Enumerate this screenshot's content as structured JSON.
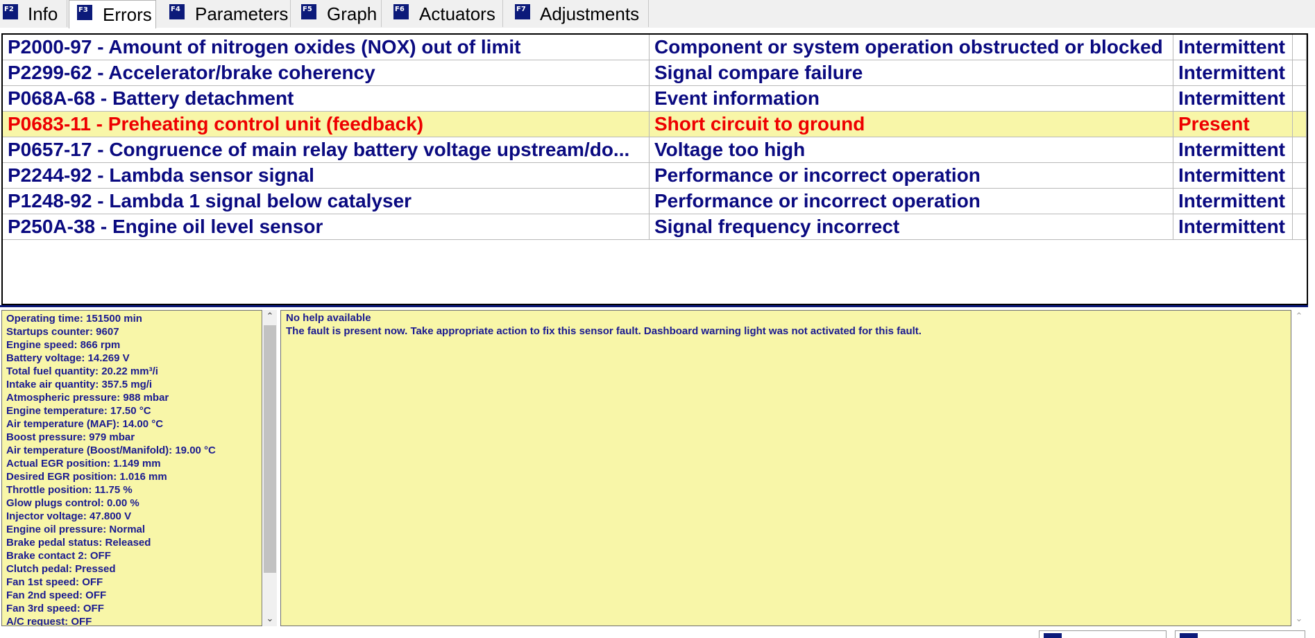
{
  "tabs": [
    {
      "key": "F2",
      "label": "Info",
      "active": false
    },
    {
      "key": "F3",
      "label": "Errors",
      "active": true
    },
    {
      "key": "F4",
      "label": "Parameters",
      "active": false
    },
    {
      "key": "F5",
      "label": "Graph",
      "active": false
    },
    {
      "key": "F6",
      "label": "Actuators",
      "active": false
    },
    {
      "key": "F7",
      "label": "Adjustments",
      "active": false
    }
  ],
  "errors": [
    {
      "code": "P2000-97 - Amount of nitrogen oxides (NOX) out of limit",
      "description": "Component or system operation obstructed or blocked",
      "type": "Intermittent"
    },
    {
      "code": "P2299-62 - Accelerator/brake coherency",
      "description": "Signal compare failure",
      "type": "Intermittent"
    },
    {
      "code": "P068A-68 - Battery detachment",
      "description": "Event information",
      "type": "Intermittent"
    },
    {
      "code": "P0683-11 - Preheating control unit (feedback)",
      "description": "Short circuit to ground",
      "type": "Present",
      "selected": true
    },
    {
      "code": "P0657-17 - Congruence of main relay battery voltage upstream/do...",
      "description": "Voltage too high",
      "type": "Intermittent"
    },
    {
      "code": "P2244-92 - Lambda sensor signal",
      "description": "Performance or incorrect operation",
      "type": "Intermittent"
    },
    {
      "code": "P1248-92 - Lambda 1 signal below catalyser",
      "description": "Performance or incorrect operation",
      "type": "Intermittent"
    },
    {
      "code": "P250A-38 - Engine oil level sensor",
      "description": "Signal frequency incorrect",
      "type": "Intermittent"
    }
  ],
  "parameters": [
    "Operating time: 151500 min",
    "Startups counter: 9607",
    "Engine speed: 866 rpm",
    "Battery voltage: 14.269 V",
    "Total fuel quantity: 20.22 mm³/i",
    "Intake air quantity: 357.5 mg/i",
    "Atmospheric pressure: 988 mbar",
    "Engine temperature: 17.50 °C",
    "Air temperature (MAF): 14.00 °C",
    "Boost pressure: 979 mbar",
    "Air temperature (Boost/Manifold): 19.00 °C",
    "Actual EGR position: 1.149 mm",
    "Desired EGR position: 1.016 mm",
    "Throttle position: 11.75 %",
    "Glow plugs control: 0.00 %",
    "Injector voltage: 47.800 V",
    "Engine oil pressure: Normal",
    "Brake pedal status: Released",
    "Brake contact 2: OFF",
    "Clutch pedal: Pressed",
    "Fan 1st speed: OFF",
    "Fan 2nd speed: OFF",
    "Fan 3rd speed: OFF",
    "A/C request: OFF"
  ],
  "help": {
    "title": "No help available",
    "text": "The fault is present now. Take appropriate action to fix this sensor fault. Dashboard warning light was not activated for this fault."
  },
  "icons": {
    "scroll_up": "chevron-up-icon",
    "scroll_down": "chevron-down-icon"
  },
  "colors": {
    "text_primary": "#0a0a80",
    "text_error": "#ee0000",
    "highlight_bg": "#f8f6a8",
    "fkey_badge": "#0c1a7a"
  }
}
